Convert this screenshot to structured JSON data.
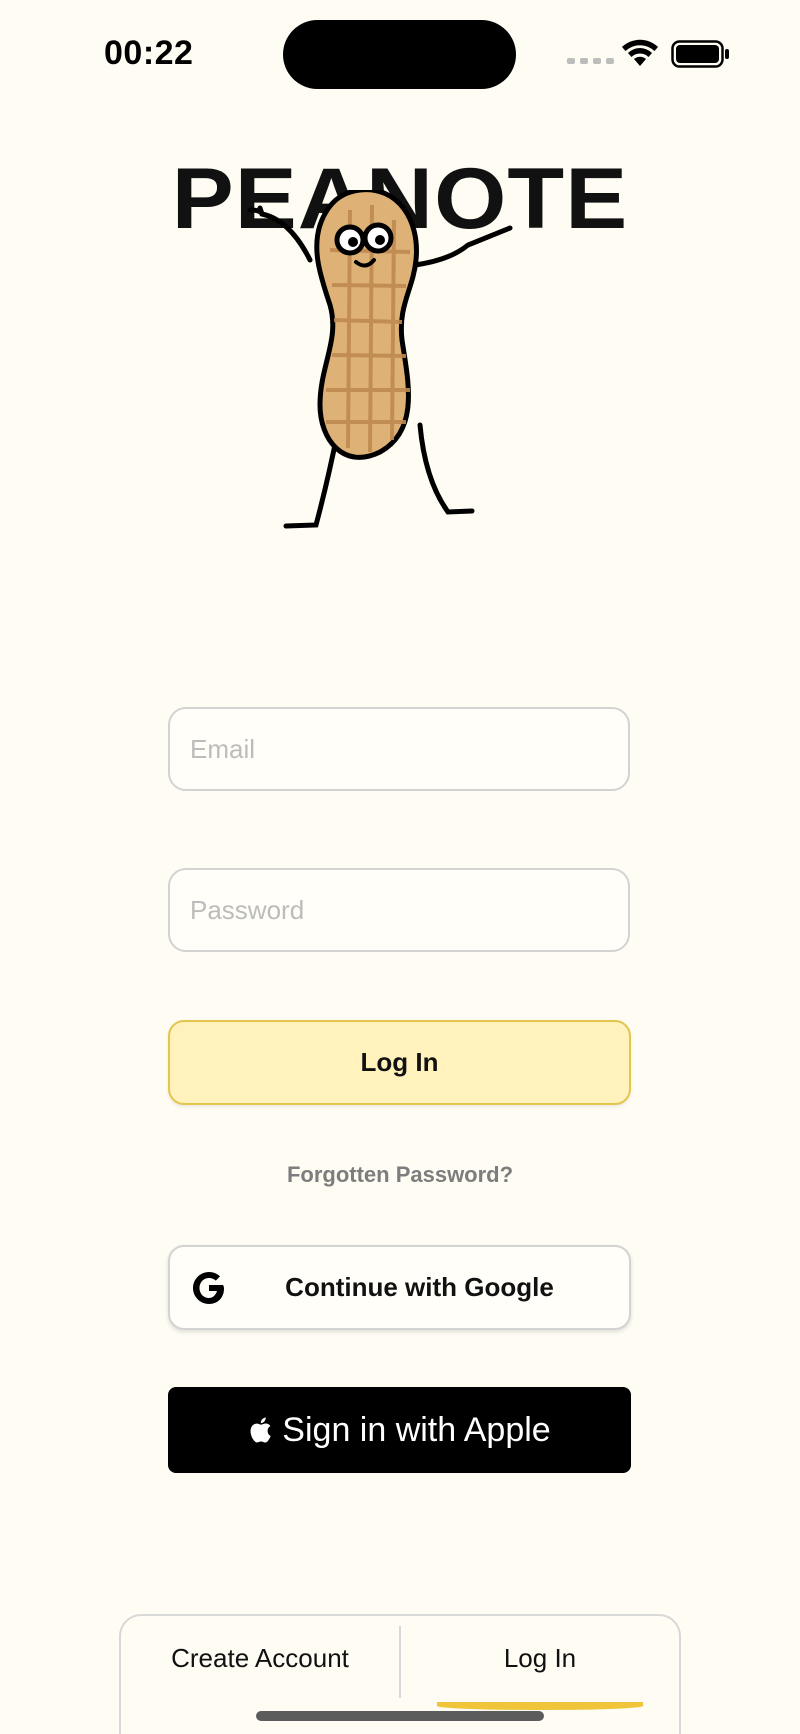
{
  "status_bar": {
    "time": "00:22"
  },
  "logo": {
    "title": "PEANOTE",
    "mascot_icon": "peanut-mascot-icon"
  },
  "form": {
    "email_placeholder": "Email",
    "password_placeholder": "Password",
    "login_label": "Log In",
    "forgot_label": "Forgotten Password?"
  },
  "social": {
    "google_label": "Continue with Google",
    "google_icon": "google-g-icon",
    "apple_label": "Sign in with Apple",
    "apple_icon": "apple-logo-icon"
  },
  "tabs": {
    "items": [
      {
        "label": "Create Account",
        "selected": false
      },
      {
        "label": "Log In",
        "selected": true
      }
    ]
  },
  "colors": {
    "background": "#fefcf3",
    "accent_yellow": "#fff2bd",
    "accent_border": "#e4c64d",
    "indicator": "#f0c53a"
  }
}
